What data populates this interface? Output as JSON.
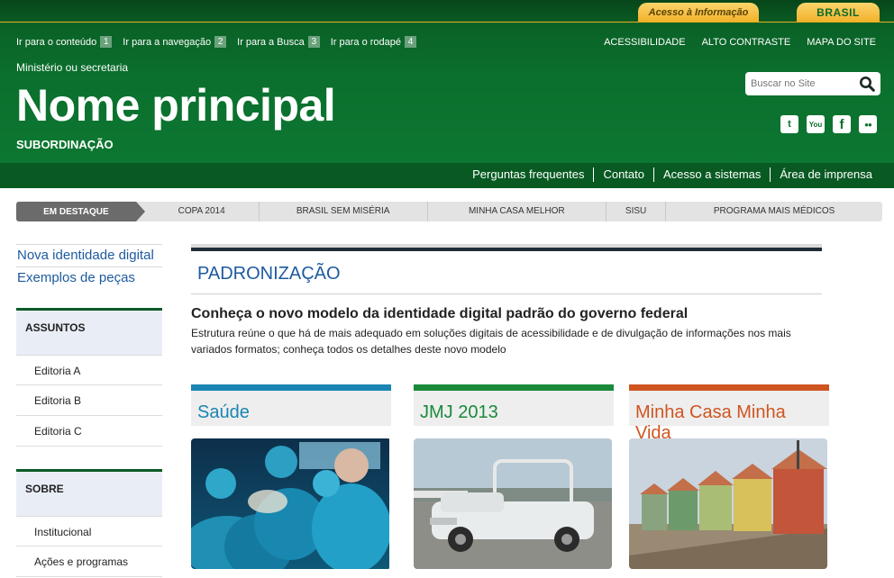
{
  "topbar": {
    "acesso_label": "Acesso à Informação",
    "brasil_label": "BRASIL"
  },
  "skip_links": [
    {
      "label": "Ir para o conteúdo",
      "num": "1"
    },
    {
      "label": "Ir para a navegação",
      "num": "2"
    },
    {
      "label": "Ir para a Busca",
      "num": "3"
    },
    {
      "label": "Ir para o rodapé",
      "num": "4"
    }
  ],
  "top_links": [
    "ACESSIBILIDADE",
    "ALTO CONTRASTE",
    "MAPA DO SITE"
  ],
  "header": {
    "ministry": "Ministério ou secretaria",
    "title": "Nome principal",
    "subordination": "SUBORDINAÇÃO"
  },
  "search": {
    "placeholder": "Buscar no Site"
  },
  "social": [
    "twitter-icon",
    "youtube-icon",
    "facebook-icon",
    "flickr-icon"
  ],
  "social_glyphs": {
    "twitter": "t",
    "youtube": "You",
    "facebook": "f",
    "flickr": "●●"
  },
  "service_links": [
    "Perguntas frequentes",
    "Contato",
    "Acesso a sistemas",
    "Área de imprensa"
  ],
  "highlights": {
    "label": "EM DESTAQUE",
    "items": [
      "COPA 2014",
      "BRASIL SEM MISÉRIA",
      "MINHA CASA MELHOR",
      "SISU",
      "PROGRAMA MAIS MÉDICOS"
    ]
  },
  "sidebar": {
    "links": [
      "Nova identidade digital",
      "Exemplos de peças"
    ],
    "sections": [
      {
        "title": "ASSUNTOS",
        "items": [
          "Editoria A",
          "Editoria B",
          "Editoria C"
        ]
      },
      {
        "title": "SOBRE",
        "items": [
          "Institucional",
          "Ações e programas"
        ]
      }
    ]
  },
  "main": {
    "section_title": "PADRONIZAÇÃO",
    "headline": "Conheça o novo modelo da identidade digital padrão do governo federal",
    "lead": "Estrutura reúne o que há de mais adequado em soluções digitais de acessibilidade e de divulgação de informações nos mais variados formatos; conheça todos os detalhes deste novo modelo"
  },
  "cards": [
    {
      "title": "Saúde",
      "color": "#1a85b3"
    },
    {
      "title": "JMJ 2013",
      "color": "#1a8a3a"
    },
    {
      "title": "Minha Casa Minha Vida",
      "color": "#cf5520"
    }
  ],
  "colors": {
    "header_green": "#0b6f2d",
    "accent_gold": "#f2b22b",
    "link_blue": "#1d5a9f"
  }
}
